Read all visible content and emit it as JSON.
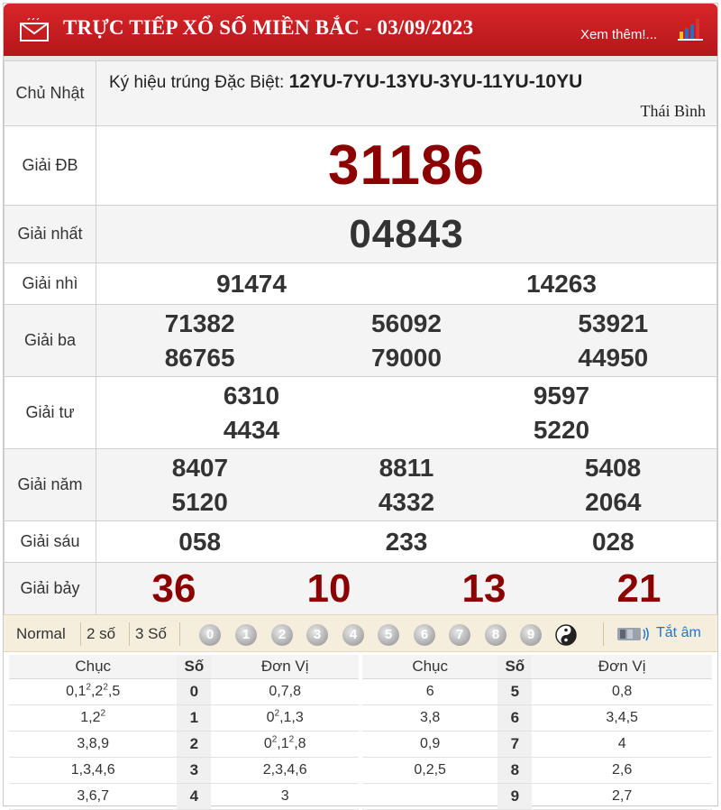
{
  "header": {
    "title": "TRỰC TIẾP XỔ SỐ MIỀN BẮC - 03/09/2023",
    "more_link": "Xem thêm!...",
    "icon_mail": "envelope-icon",
    "icon_stats": "bar-chart-icon"
  },
  "day": "Chủ Nhật",
  "special_codes": {
    "label": "Ký hiệu trúng Đặc Biệt:",
    "codes": "12YU-7YU-13YU-3YU-11YU-10YU",
    "province": "Thái Bình"
  },
  "prizes": {
    "db": {
      "label": "Giải ĐB",
      "numbers": [
        "31186"
      ]
    },
    "nhat": {
      "label": "Giải nhất",
      "numbers": [
        "04843"
      ]
    },
    "nhi": {
      "label": "Giải nhì",
      "numbers": [
        "91474",
        "14263"
      ]
    },
    "ba": {
      "label": "Giải ba",
      "numbers": [
        "71382",
        "56092",
        "53921",
        "86765",
        "79000",
        "44950"
      ]
    },
    "tu": {
      "label": "Giải tư",
      "numbers": [
        "6310",
        "9597",
        "4434",
        "5220"
      ]
    },
    "nam": {
      "label": "Giải năm",
      "numbers": [
        "8407",
        "8811",
        "5408",
        "5120",
        "4332",
        "2064"
      ]
    },
    "sau": {
      "label": "Giải sáu",
      "numbers": [
        "058",
        "233",
        "028"
      ]
    },
    "bay": {
      "label": "Giải bảy",
      "numbers": [
        "36",
        "10",
        "13",
        "21"
      ]
    }
  },
  "filter_bar": {
    "options": [
      "Normal",
      "2 số",
      "3 Số"
    ],
    "digits": [
      "0",
      "1",
      "2",
      "3",
      "4",
      "5",
      "6",
      "7",
      "8",
      "9"
    ],
    "mute_label": "Tắt âm"
  },
  "stats": {
    "headers": [
      "Chục",
      "Số",
      "Đơn Vị"
    ],
    "left": [
      {
        "chuc": "0,1<sup>2</sup>,2<sup>2</sup>,5",
        "so": "0",
        "donvi": "0,7,8"
      },
      {
        "chuc": "1,2<sup>2</sup>",
        "so": "1",
        "donvi": "0<sup>2</sup>,1,3"
      },
      {
        "chuc": "3,8,9",
        "so": "2",
        "donvi": "0<sup>2</sup>,1<sup>2</sup>,8"
      },
      {
        "chuc": "1,3,4,6",
        "so": "3",
        "donvi": "2,3,4,6"
      },
      {
        "chuc": "3,6,7",
        "so": "4",
        "donvi": "3"
      }
    ],
    "right": [
      {
        "chuc": "6",
        "so": "5",
        "donvi": "0,8"
      },
      {
        "chuc": "3,8",
        "so": "6",
        "donvi": "3,4,5"
      },
      {
        "chuc": "0,9",
        "so": "7",
        "donvi": "4"
      },
      {
        "chuc": "0,2,5",
        "so": "8",
        "donvi": "2,6"
      },
      {
        "chuc": "",
        "so": "9",
        "donvi": "2,7"
      }
    ]
  },
  "colors": {
    "header": "#c41e22",
    "special": "#8b0000",
    "link": "#2477c5"
  }
}
